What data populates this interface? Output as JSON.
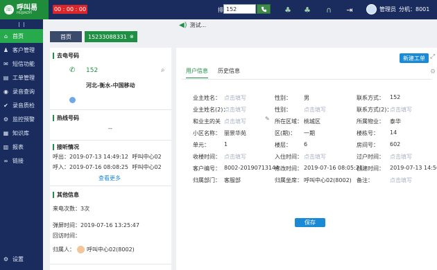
{
  "topbar": {
    "logo_name": "呼叫易",
    "logo_sub": "HUJIAOYI",
    "timer": "00 : 00 : 00",
    "queue_label": "排队：0",
    "phone_value": "152",
    "user_name": "管理员",
    "extension": "分机：8001"
  },
  "sidebar": {
    "items": [
      {
        "label": "首页",
        "icon": "home-icon"
      },
      {
        "label": "客户管理",
        "icon": "users-icon"
      },
      {
        "label": "短信功能",
        "icon": "sms-icon"
      },
      {
        "label": "工单管理",
        "icon": "ticket-icon"
      },
      {
        "label": "录音查询",
        "icon": "record-icon"
      },
      {
        "label": "录音质检",
        "icon": "check-icon"
      },
      {
        "label": "监控预警",
        "icon": "monitor-icon"
      },
      {
        "label": "知识库",
        "icon": "book-icon"
      },
      {
        "label": "报表",
        "icon": "chart-icon"
      },
      {
        "label": "链接",
        "icon": "link-icon"
      }
    ],
    "settings": "设置"
  },
  "main": {
    "notice": "测试...",
    "tabs": [
      {
        "label": "首页"
      },
      {
        "label": "15233088331"
      }
    ]
  },
  "left": {
    "outgoing_title": "去电号码",
    "phone": "152",
    "region": "河北-衡水-中国移动",
    "hotline_title": "热线号码",
    "hotline_value": "--",
    "contact_title": "接听情况",
    "calls": [
      {
        "type": "呼出：",
        "time": "2019-07-13 14:49:12",
        "agent": "呼叫中心02"
      },
      {
        "type": "呼入：",
        "time": "2019-07-16 08:08:25",
        "agent": "呼叫中心02"
      }
    ],
    "more": "查看更多",
    "other_title": "其他信息",
    "call_count": "来电次数：3次",
    "popup_time": "弹屏时间：2019-07-16 13:25:47",
    "callback_time": "回访时间：",
    "owner_label": "归属人：",
    "owner_value": "呼叫中心02(8002)"
  },
  "right": {
    "new_ticket": "新建工单",
    "tabs": [
      "用户信息",
      "历史信息"
    ],
    "placeholder": "点击填写",
    "rows": [
      [
        {
          "label": "业主姓名：",
          "value": ""
        },
        {
          "label": "性别：",
          "value": "男"
        },
        {
          "label": "联系方式：",
          "value": "152"
        }
      ],
      [
        {
          "label": "业主姓名(2)：",
          "value": ""
        },
        {
          "label": "性别：",
          "value": ""
        },
        {
          "label": "联系方式(2)：",
          "value": ""
        }
      ],
      [
        {
          "label": "和业主的关",
          "value": ""
        },
        {
          "label": "所在区域：",
          "value": "桃城区"
        },
        {
          "label": "所属物业：",
          "value": "泰华"
        }
      ],
      [
        {
          "label": "小区名称：",
          "value": "丽景华苑"
        },
        {
          "label": "区(期)：",
          "value": "一期"
        },
        {
          "label": "楼栋号：",
          "value": "14"
        }
      ],
      [
        {
          "label": "单元：",
          "value": "1"
        },
        {
          "label": "楼层：",
          "value": "6"
        },
        {
          "label": "房间号：",
          "value": "602"
        }
      ],
      [
        {
          "label": "收楼时间：",
          "value": ""
        },
        {
          "label": "入住时间：",
          "value": ""
        },
        {
          "label": "过户时间：",
          "value": ""
        }
      ],
      [
        {
          "label": "客户编号：",
          "value": "8002-20190713144"
        },
        {
          "label": "修改时间：",
          "value": "2019-07-16 08:05:21"
        },
        {
          "label": "创建时间：",
          "value": "2019-07-13 14:56:34"
        }
      ],
      [
        {
          "label": "归属部门：",
          "value": "客服部"
        },
        {
          "label": "归属坐席：",
          "value": "呼叫中心02(8002)"
        },
        {
          "label": "备注：",
          "value": ""
        }
      ]
    ],
    "save": "保存"
  }
}
